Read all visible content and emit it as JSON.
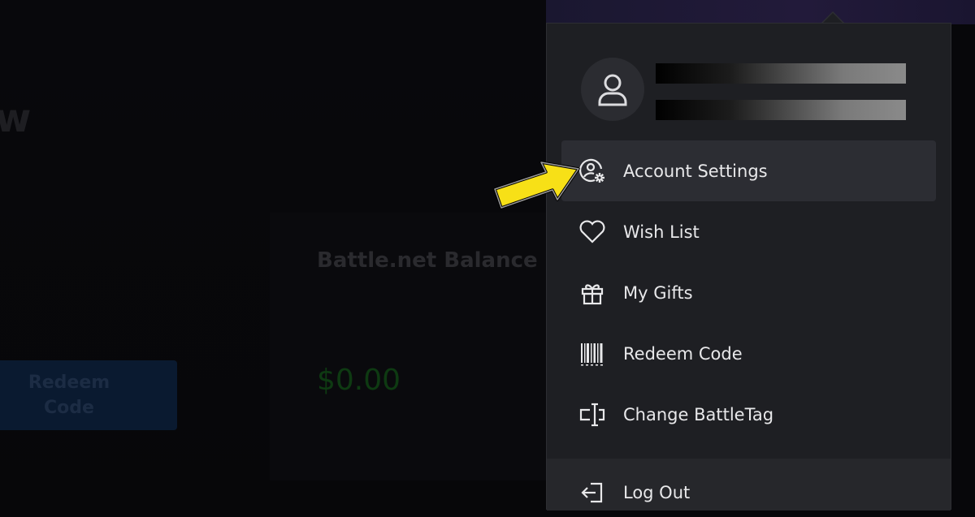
{
  "background": {
    "heading_fragment": "w",
    "card_title": "Battle.net Balance",
    "balance": "$0.00",
    "redeem_button_line1": "Redeem",
    "redeem_button_line2": "Code"
  },
  "menu": {
    "items": [
      {
        "label": "Account Settings",
        "icon": "account-settings-icon",
        "active": true
      },
      {
        "label": "Wish List",
        "icon": "heart-icon"
      },
      {
        "label": "My Gifts",
        "icon": "gift-icon"
      },
      {
        "label": "Redeem Code",
        "icon": "barcode-icon"
      },
      {
        "label": "Change BattleTag",
        "icon": "battletag-icon"
      }
    ],
    "logout_label": "Log Out"
  },
  "colors": {
    "menu_bg": "#1e1f23",
    "highlight": "#2c2d33",
    "annotation_arrow": "#f7e017"
  }
}
